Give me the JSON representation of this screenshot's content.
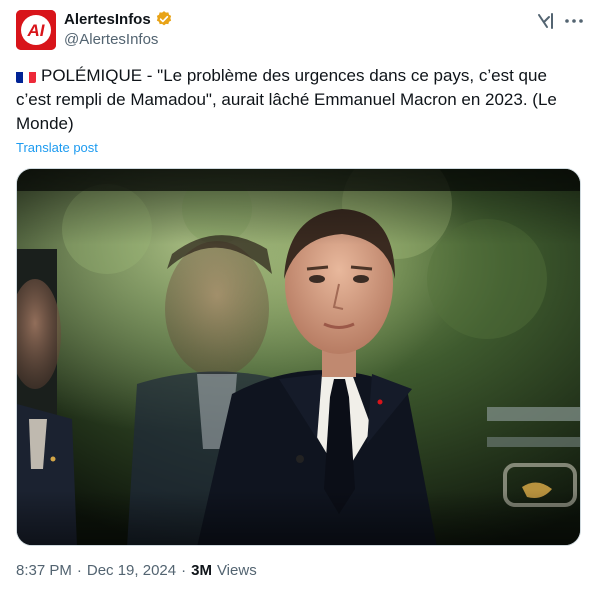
{
  "account": {
    "display_name": "AlertesInfos",
    "handle": "@AlertesInfos",
    "avatar_text": "AI",
    "verified": true,
    "verified_color": "#e8a317"
  },
  "header_actions": {
    "grok_icon": "grok-icon",
    "more_icon": "more-icon"
  },
  "post": {
    "flag": "france-flag",
    "text": "POLÉMIQUE - \"Le problème des urgences dans ce pays, c’est que c’est rempli de Mamadou\", aurait lâché Emmanuel Macron en 2023. (Le Monde)",
    "translate_label": "Translate post"
  },
  "footer": {
    "time": "8:37 PM",
    "separator": "·",
    "date": "Dec 19, 2024",
    "views_count": "3M",
    "views_label": "Views"
  },
  "colors": {
    "link": "#1d9bf0",
    "secondary": "#536471",
    "brand_red": "#d8141a"
  }
}
